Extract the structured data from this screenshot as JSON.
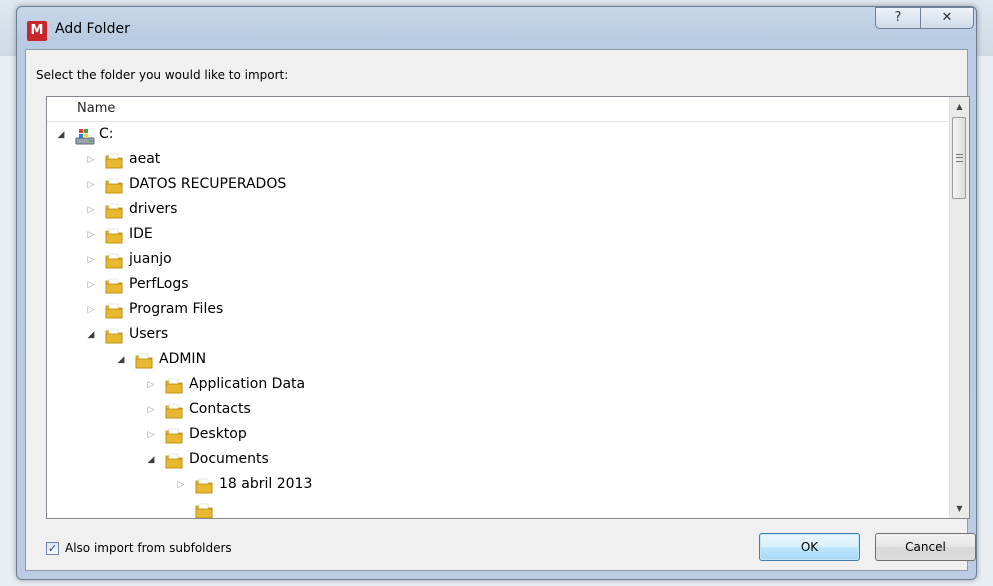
{
  "window": {
    "title": "Add Folder",
    "icon": "mediamonkey-app-icon",
    "help_glyph": "?",
    "close_glyph": "✕"
  },
  "prompt": "Select the folder you would like to import:",
  "tree": {
    "column_header": "Name",
    "items": [
      {
        "label": "C:",
        "depth": 0,
        "state": "expanded",
        "icon": "drive-icon"
      },
      {
        "label": "aeat",
        "depth": 1,
        "state": "collapsed",
        "icon": "folder-icon"
      },
      {
        "label": "DATOS RECUPERADOS",
        "depth": 1,
        "state": "collapsed",
        "icon": "folder-icon"
      },
      {
        "label": "drivers",
        "depth": 1,
        "state": "collapsed",
        "icon": "folder-icon"
      },
      {
        "label": "IDE",
        "depth": 1,
        "state": "collapsed",
        "icon": "folder-icon"
      },
      {
        "label": "juanjo",
        "depth": 1,
        "state": "collapsed",
        "icon": "folder-icon"
      },
      {
        "label": "PerfLogs",
        "depth": 1,
        "state": "collapsed",
        "icon": "folder-icon"
      },
      {
        "label": "Program Files",
        "depth": 1,
        "state": "collapsed",
        "icon": "folder-icon"
      },
      {
        "label": "Users",
        "depth": 1,
        "state": "expanded",
        "icon": "folder-icon"
      },
      {
        "label": "ADMIN",
        "depth": 2,
        "state": "expanded",
        "icon": "folder-icon"
      },
      {
        "label": "Application Data",
        "depth": 3,
        "state": "collapsed",
        "icon": "folder-icon"
      },
      {
        "label": "Contacts",
        "depth": 3,
        "state": "collapsed",
        "icon": "folder-icon"
      },
      {
        "label": "Desktop",
        "depth": 3,
        "state": "collapsed",
        "icon": "folder-icon"
      },
      {
        "label": "Documents",
        "depth": 3,
        "state": "expanded",
        "icon": "folder-icon"
      },
      {
        "label": "18 abril 2013",
        "depth": 4,
        "state": "collapsed",
        "icon": "folder-icon"
      },
      {
        "label": "",
        "depth": 4,
        "state": "none",
        "icon": "folder-icon"
      }
    ]
  },
  "options": {
    "subfolders_label": "Also import from subfolders",
    "subfolders_checked": true
  },
  "buttons": {
    "ok": "OK",
    "cancel": "Cancel"
  },
  "colors": {
    "folder": "#e8b830",
    "ok_border": "#3c7fb1",
    "app_icon": "#c8262a"
  }
}
